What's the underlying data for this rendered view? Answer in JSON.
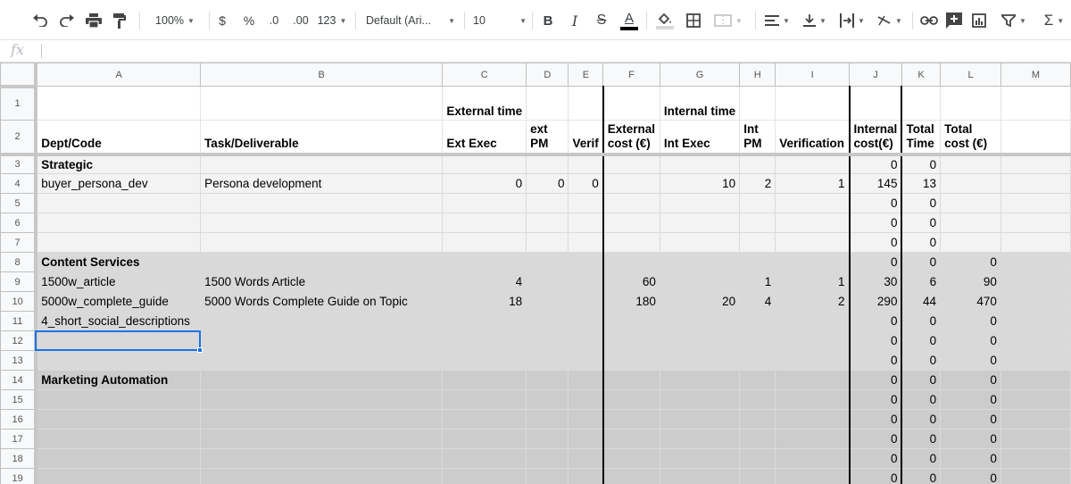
{
  "toolbar": {
    "zoom": "100%",
    "currency": "$",
    "percent": "%",
    "dec_less": ".0",
    "dec_more": ".00",
    "more_formats": "123",
    "font": "Default (Ari...",
    "font_size": "10",
    "bold": "B",
    "italic": "I",
    "strike": "S",
    "text_color": "A",
    "sum": "Σ"
  },
  "formula_bar": {
    "fx": "fx",
    "value": ""
  },
  "columns": [
    "A",
    "B",
    "C",
    "D",
    "E",
    "F",
    "G",
    "H",
    "I",
    "J",
    "K",
    "L",
    "M"
  ],
  "rows": [
    {
      "num": "1",
      "style": "header",
      "cells": [
        "",
        "",
        "External time",
        "",
        "",
        "",
        "Internal time",
        "",
        "",
        "",
        "",
        "",
        ""
      ]
    },
    {
      "num": "2",
      "style": "header",
      "cells": [
        "Dept/Code",
        "Task/Deliverable",
        "Ext Exec",
        "ext PM",
        "Verif",
        "External cost (€)",
        "Int Exec",
        "Int PM",
        "Verification",
        "Internal cost(€)",
        "Total Time",
        "Total cost (€)",
        ""
      ]
    },
    {
      "num": "3",
      "style": "s1",
      "cells": [
        "Strategic",
        "",
        "",
        "",
        "",
        "",
        "",
        "",
        "",
        "0",
        "0",
        "",
        ""
      ]
    },
    {
      "num": "4",
      "style": "s1",
      "cells": [
        "buyer_persona_dev",
        "Persona development",
        "0",
        "0",
        "0",
        "",
        "10",
        "2",
        "1",
        "145",
        "13",
        "",
        ""
      ]
    },
    {
      "num": "5",
      "style": "s1",
      "cells": [
        "",
        "",
        "",
        "",
        "",
        "",
        "",
        "",
        "",
        "0",
        "0",
        "",
        ""
      ]
    },
    {
      "num": "6",
      "style": "s1",
      "cells": [
        "",
        "",
        "",
        "",
        "",
        "",
        "",
        "",
        "",
        "0",
        "0",
        "",
        ""
      ]
    },
    {
      "num": "7",
      "style": "s1",
      "cells": [
        "",
        "",
        "",
        "",
        "",
        "",
        "",
        "",
        "",
        "0",
        "0",
        "",
        ""
      ]
    },
    {
      "num": "8",
      "style": "s2",
      "cells": [
        "Content Services",
        "",
        "",
        "",
        "",
        "",
        "",
        "",
        "",
        "0",
        "0",
        "0",
        ""
      ]
    },
    {
      "num": "9",
      "style": "s2",
      "cells": [
        "1500w_article",
        "1500 Words Article",
        "4",
        "",
        "",
        "60",
        "",
        "1",
        "1",
        "30",
        "6",
        "90",
        ""
      ]
    },
    {
      "num": "10",
      "style": "s2",
      "cells": [
        "5000w_complete_guide",
        "5000 Words Complete Guide on Topic",
        "18",
        "",
        "",
        "180",
        "20",
        "4",
        "2",
        "290",
        "44",
        "470",
        ""
      ]
    },
    {
      "num": "11",
      "style": "s2",
      "cells": [
        "4_short_social_descriptions",
        "",
        "",
        "",
        "",
        "",
        "",
        "",
        "",
        "0",
        "0",
        "0",
        ""
      ]
    },
    {
      "num": "12",
      "style": "s2",
      "cells": [
        "",
        "",
        "",
        "",
        "",
        "",
        "",
        "",
        "",
        "0",
        "0",
        "0",
        ""
      ]
    },
    {
      "num": "13",
      "style": "s2",
      "cells": [
        "",
        "",
        "",
        "",
        "",
        "",
        "",
        "",
        "",
        "0",
        "0",
        "0",
        ""
      ]
    },
    {
      "num": "14",
      "style": "s3",
      "cells": [
        "Marketing Automation",
        "",
        "",
        "",
        "",
        "",
        "",
        "",
        "",
        "0",
        "0",
        "0",
        ""
      ]
    },
    {
      "num": "15",
      "style": "s3",
      "cells": [
        "",
        "",
        "",
        "",
        "",
        "",
        "",
        "",
        "",
        "0",
        "0",
        "0",
        ""
      ]
    },
    {
      "num": "16",
      "style": "s3",
      "cells": [
        "",
        "",
        "",
        "",
        "",
        "",
        "",
        "",
        "",
        "0",
        "0",
        "0",
        ""
      ]
    },
    {
      "num": "17",
      "style": "s3",
      "cells": [
        "",
        "",
        "",
        "",
        "",
        "",
        "",
        "",
        "",
        "0",
        "0",
        "0",
        ""
      ]
    },
    {
      "num": "18",
      "style": "s3",
      "cells": [
        "",
        "",
        "",
        "",
        "",
        "",
        "",
        "",
        "",
        "0",
        "0",
        "0",
        ""
      ]
    },
    {
      "num": "19",
      "style": "s3",
      "cells": [
        "",
        "",
        "",
        "",
        "",
        "",
        "",
        "",
        "",
        "0",
        "0",
        "0",
        ""
      ]
    }
  ]
}
